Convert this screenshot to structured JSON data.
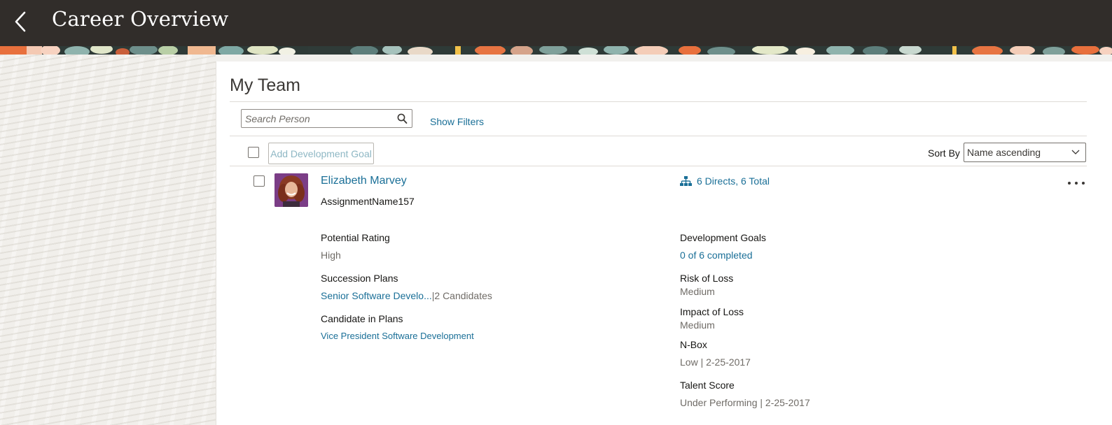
{
  "header": {
    "title": "Career Overview",
    "back_icon": "chevron-left-icon"
  },
  "team": {
    "title": "My Team",
    "search": {
      "placeholder": "Search Person",
      "value": ""
    },
    "show_filters_label": "Show Filters",
    "add_goal_label": "Add Development Goal",
    "sort": {
      "label": "Sort By",
      "selected": "Name ascending"
    }
  },
  "person": {
    "name": "Elizabeth Marvey",
    "assignment": "AssignmentName157",
    "directs_label": "6 Directs, 6 Total",
    "fields": {
      "potential_rating_label": "Potential Rating",
      "potential_rating_value": "High",
      "succession_plans_label": "Succession Plans",
      "succession_plan_link": "Senior Software Develo...",
      "succession_separator": "|",
      "succession_candidates": "2 Candidates",
      "candidate_in_plans_label": "Candidate in Plans",
      "candidate_in_plans_value": "Vice President Software Development",
      "development_goals_label": "Development Goals",
      "development_goals_value": "0 of 6 completed",
      "risk_of_loss_label": "Risk of Loss",
      "risk_of_loss_value": "Medium",
      "impact_of_loss_label": "Impact of Loss",
      "impact_of_loss_value": "Medium",
      "nbox_label": "N-Box",
      "nbox_value": "Low | 2-25-2017",
      "talent_score_label": "Talent Score",
      "talent_score_value": "Under Performing | 2-25-2017"
    }
  },
  "colors": {
    "header_bg": "#312d2a",
    "link": "#1a6f97",
    "page_bg": "#f1f0ed"
  }
}
